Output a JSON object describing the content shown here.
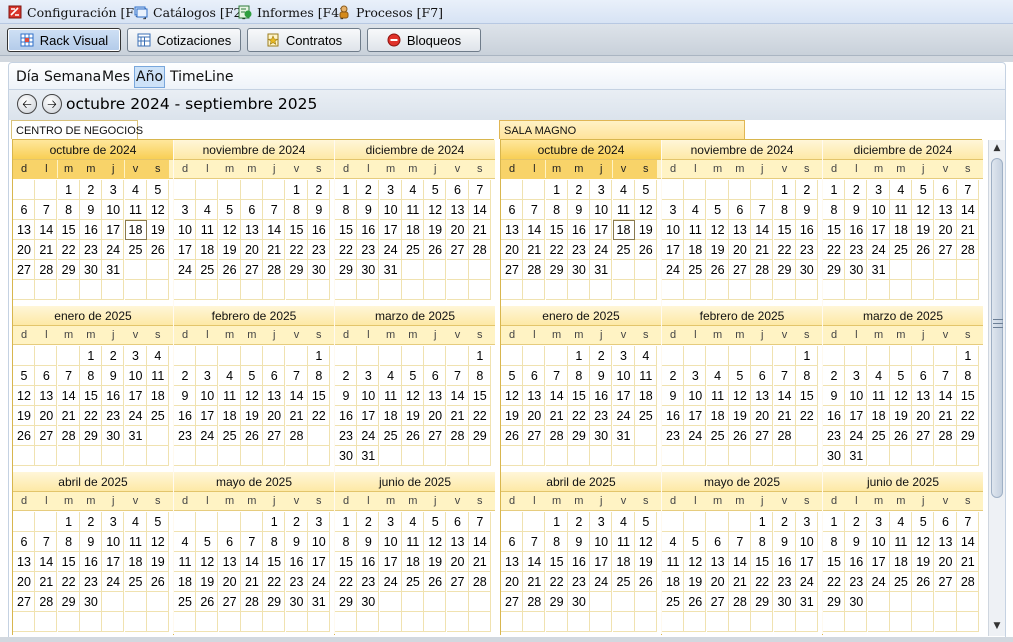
{
  "menu": [
    {
      "label": "Configuración [F1]",
      "icon": "config-icon",
      "color": "#d9342b"
    },
    {
      "label": "Catálogos [F2]",
      "icon": "catalog-icon",
      "color": "#2f6fc9"
    },
    {
      "label": "Informes [F4]",
      "icon": "report-icon",
      "color": "#2e9e3e"
    },
    {
      "label": "Procesos [F7]",
      "icon": "process-icon",
      "color": "#d48a1c"
    }
  ],
  "toolbar": [
    {
      "label": "Rack Visual",
      "icon": "rack-icon",
      "active": true
    },
    {
      "label": "Cotizaciones",
      "icon": "quote-icon",
      "active": false
    },
    {
      "label": "Contratos",
      "icon": "contract-icon",
      "active": false
    },
    {
      "label": "Bloqueos",
      "icon": "block-icon",
      "active": false
    }
  ],
  "views": [
    "Día",
    "Semana",
    "Mes",
    "Año",
    "TimeLine"
  ],
  "active_view": "Año",
  "nav": {
    "prev": "prev-arrow-icon",
    "next": "next-arrow-icon",
    "range": "octubre 2024 - septiembre 2025"
  },
  "weekdays": [
    "d",
    "l",
    "m",
    "m",
    "j",
    "v",
    "s"
  ],
  "today": {
    "month_index": 0,
    "day": 18
  },
  "months": [
    {
      "title": "octubre de 2024",
      "start": 2,
      "days": 31
    },
    {
      "title": "noviembre de 2024",
      "start": 5,
      "days": 30
    },
    {
      "title": "diciembre de 2024",
      "start": 0,
      "days": 31
    },
    {
      "title": "enero de 2025",
      "start": 3,
      "days": 31
    },
    {
      "title": "febrero de 2025",
      "start": 6,
      "days": 28
    },
    {
      "title": "marzo de 2025",
      "start": 6,
      "days": 31
    },
    {
      "title": "abril de 2025",
      "start": 2,
      "days": 30
    },
    {
      "title": "mayo de 2025",
      "start": 4,
      "days": 31
    },
    {
      "title": "junio de 2025",
      "start": 0,
      "days": 30
    }
  ],
  "resources": [
    {
      "name": "CENTRO DE NEGOCIOS"
    },
    {
      "name": "SALA MAGNO"
    }
  ],
  "colors": {
    "accent": "#f8cf55",
    "header": "#fde9a6",
    "border": "#d8b64e"
  }
}
